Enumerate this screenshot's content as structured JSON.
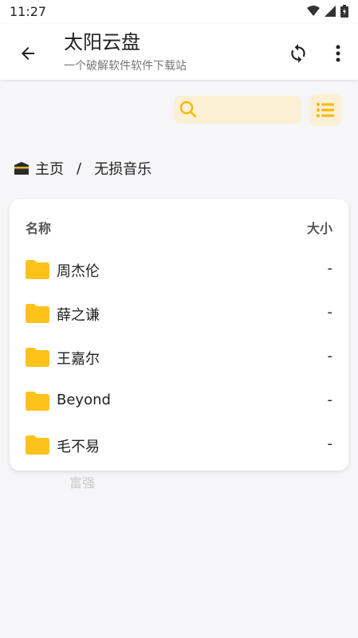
{
  "status_bar": {
    "time": "11:27"
  },
  "app_bar": {
    "title": "太阳云盘",
    "subtitle": "一个破解软件软件下载站"
  },
  "search": {
    "placeholder": ""
  },
  "breadcrumb": {
    "home": "主页",
    "separator": "/",
    "current": "无损音乐"
  },
  "table": {
    "col_name": "名称",
    "col_size": "大小",
    "rows": [
      {
        "name": "周杰伦",
        "size": "-"
      },
      {
        "name": "薛之谦",
        "size": "-"
      },
      {
        "name": "王嘉尔",
        "size": "-"
      },
      {
        "name": "Beyond",
        "size": "-"
      },
      {
        "name": "毛不易",
        "size": "-"
      }
    ]
  },
  "ghost_text": "富强",
  "colors": {
    "accent": "#f5b800",
    "folder": "#ffc21a",
    "search_bg": "#fbefd4"
  }
}
